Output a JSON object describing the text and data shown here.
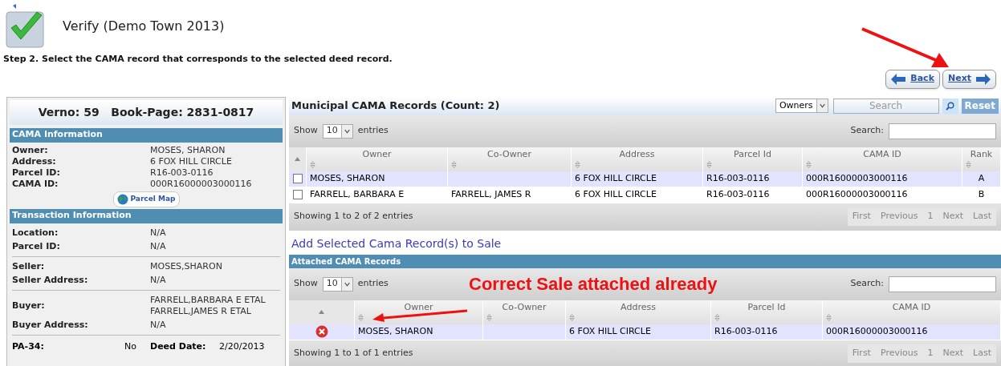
{
  "page": {
    "title": "Verify (Demo Town 2013)",
    "instruction": "Step 2. Select the CAMA record that corresponds to the selected deed record."
  },
  "nav_buttons": [
    {
      "label": "Back",
      "kind": "back"
    },
    {
      "label": "Next",
      "kind": "next"
    }
  ],
  "deed_panel": {
    "title": "Verno: 59   Book-Page: 2831-0817",
    "cama_section": {
      "heading": "CAMA Information",
      "fields": [
        {
          "label": "Owner:",
          "value": "MOSES, SHARON"
        },
        {
          "label": "Address:",
          "value": "6 FOX HILL CIRCLE"
        },
        {
          "label": "Parcel ID:",
          "value": "R16-003-0116"
        },
        {
          "label": "CAMA ID:",
          "value": "000R16000003000116"
        }
      ],
      "map_button": "Parcel Map"
    },
    "transaction_section": {
      "heading": "Transaction Information",
      "groups": [
        [
          {
            "label": "Location:",
            "value": "N/A"
          },
          {
            "label": "Parcel ID:",
            "value": "N/A"
          }
        ],
        [
          {
            "label": "Seller:",
            "value": "MOSES,SHARON"
          },
          {
            "label": "Seller Address:",
            "value": "N/A"
          }
        ],
        [
          {
            "label": "Buyer:",
            "value": "FARRELL,BARBARA E ETAL\nFARRELL,JAMES R ETAL"
          },
          {
            "label": "Buyer Address:",
            "value": "N/A"
          }
        ]
      ],
      "last_row": {
        "label": "PA-34:",
        "value": "No",
        "label_2": "Deed Date:",
        "value_2": "2/20/2013"
      }
    }
  },
  "cama_records": {
    "title": "Municipal CAMA Records (Count: 2)",
    "filter_select": "Owners",
    "search_placeholder": "Search",
    "reset_button": "Reset",
    "show_label": "Show",
    "page_size": "10",
    "entries_label": "entries",
    "search_label": "Search:",
    "columns": [
      "Owner",
      "Co-Owner",
      "Address",
      "Parcel Id",
      "CAMA ID",
      "Rank"
    ],
    "rows": [
      {
        "selected": true,
        "checked": false,
        "cells": [
          "MOSES, SHARON",
          "",
          "6 FOX HILL CIRCLE",
          "R16-003-0116",
          "000R16000003000116",
          "A"
        ]
      },
      {
        "selected": false,
        "checked": false,
        "cells": [
          "FARRELL, BARBARA E",
          "FARRELL, JAMES R",
          "6 FOX HILL CIRCLE",
          "R16-003-0116",
          "000R16000003000116",
          "B"
        ]
      }
    ],
    "info": "Showing 1 to 2 of 2 entries",
    "pager": [
      "First",
      "Previous",
      "1",
      "Next",
      "Last"
    ]
  },
  "add_link": "Add Selected Cama Record(s) to Sale",
  "attached": {
    "title": "Attached CAMA Records",
    "show_label": "Show",
    "page_size": "10",
    "entries_label": "entries",
    "search_label": "Search:",
    "columns": [
      "Owner",
      "Co-Owner",
      "Address",
      "Parcel Id",
      "CAMA ID"
    ],
    "rows": [
      {
        "selected": true,
        "cells": [
          "MOSES, SHARON",
          "",
          "6 FOX HILL CIRCLE",
          "R16-003-0116",
          "000R16000003000116"
        ]
      }
    ],
    "info": "Showing 1 to 1 of 1 entries",
    "pager": [
      "First",
      "Previous",
      "1",
      "Next",
      "Last"
    ]
  },
  "annotation": "Correct Sale attached already"
}
